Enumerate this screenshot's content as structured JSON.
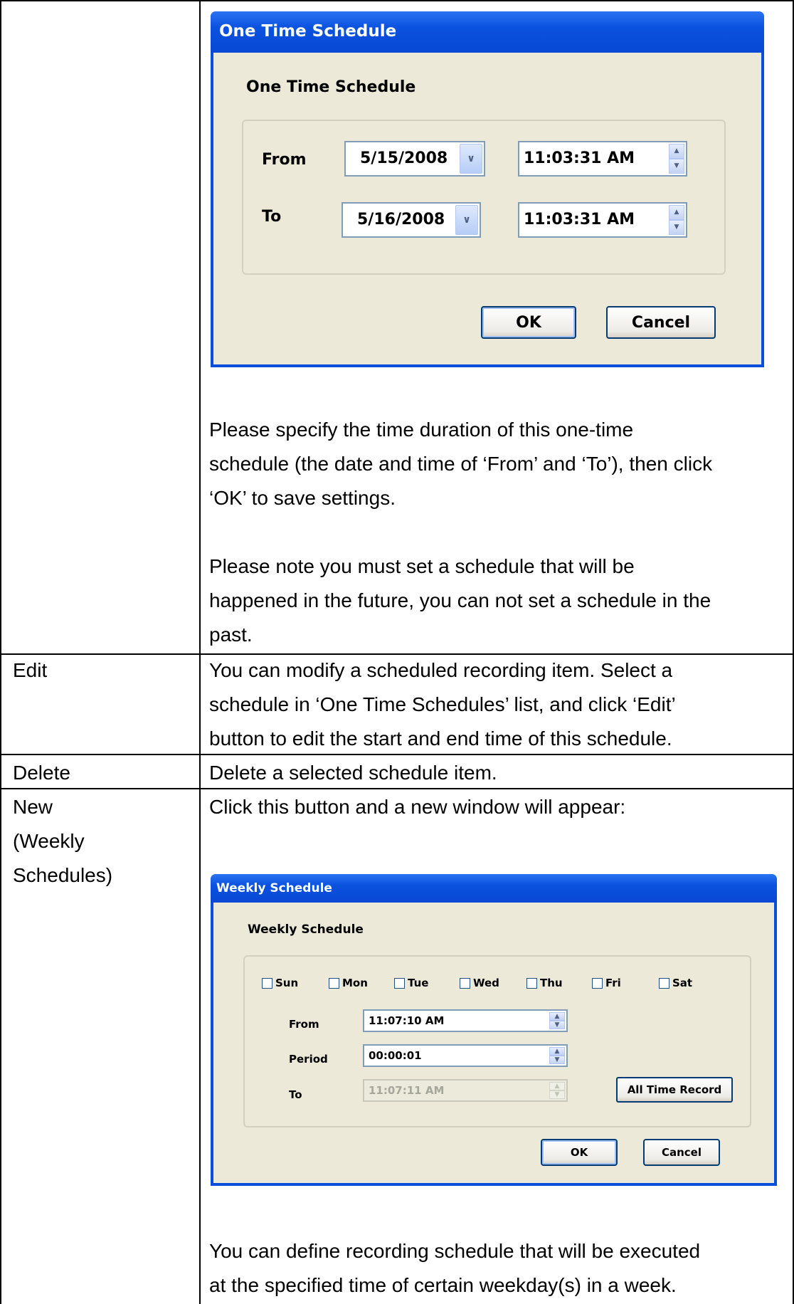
{
  "one_time_dialog": {
    "title": "One Time Schedule",
    "heading": "One Time Schedule",
    "from_label": "From",
    "from_date": "5/15/2008",
    "from_time": "11:03:31 AM",
    "to_label": "To",
    "to_date": "5/16/2008",
    "to_time": "11:03:31 AM",
    "ok_label": "OK",
    "cancel_label": "Cancel"
  },
  "one_time_description": {
    "lines": [
      "Please specify the time duration of this one-time",
      "schedule (the date and time of ‘From’ and ‘To’), then click",
      "‘OK’ to save settings."
    ]
  },
  "one_time_note": {
    "lines": [
      "Please note you must set a schedule that will be",
      "happened in the future, you can not set a schedule in the",
      "past."
    ]
  },
  "rows": {
    "edit": {
      "name": "Edit",
      "lines": [
        "You can modify a scheduled recording item. Select a",
        "schedule in ‘One Time Schedules’ list, and click ‘Edit’",
        "button to edit the start and end time of this schedule."
      ]
    },
    "delete": {
      "name": "Delete",
      "text": "Delete a selected schedule item."
    },
    "new_weekly": {
      "name_lines": [
        "New",
        "(Weekly",
        "Schedules)"
      ],
      "intro": "Click this button and a new window will appear:",
      "description_lines": [
        "You can define recording schedule that will be executed",
        "at the specified time of certain weekday(s) in a week."
      ]
    }
  },
  "weekly_dialog": {
    "title": "Weekly Schedule",
    "heading": "Weekly Schedule",
    "days": [
      "Sun",
      "Mon",
      "Tue",
      "Wed",
      "Thu",
      "Fri",
      "Sat"
    ],
    "from_label": "From",
    "from_value": "11:07:10 AM",
    "period_label": "Period",
    "period_value": "00:00:01",
    "to_label": "To",
    "to_value": "11:07:11 AM",
    "all_time_label": "All Time Record",
    "ok_label": "OK",
    "cancel_label": "Cancel"
  }
}
